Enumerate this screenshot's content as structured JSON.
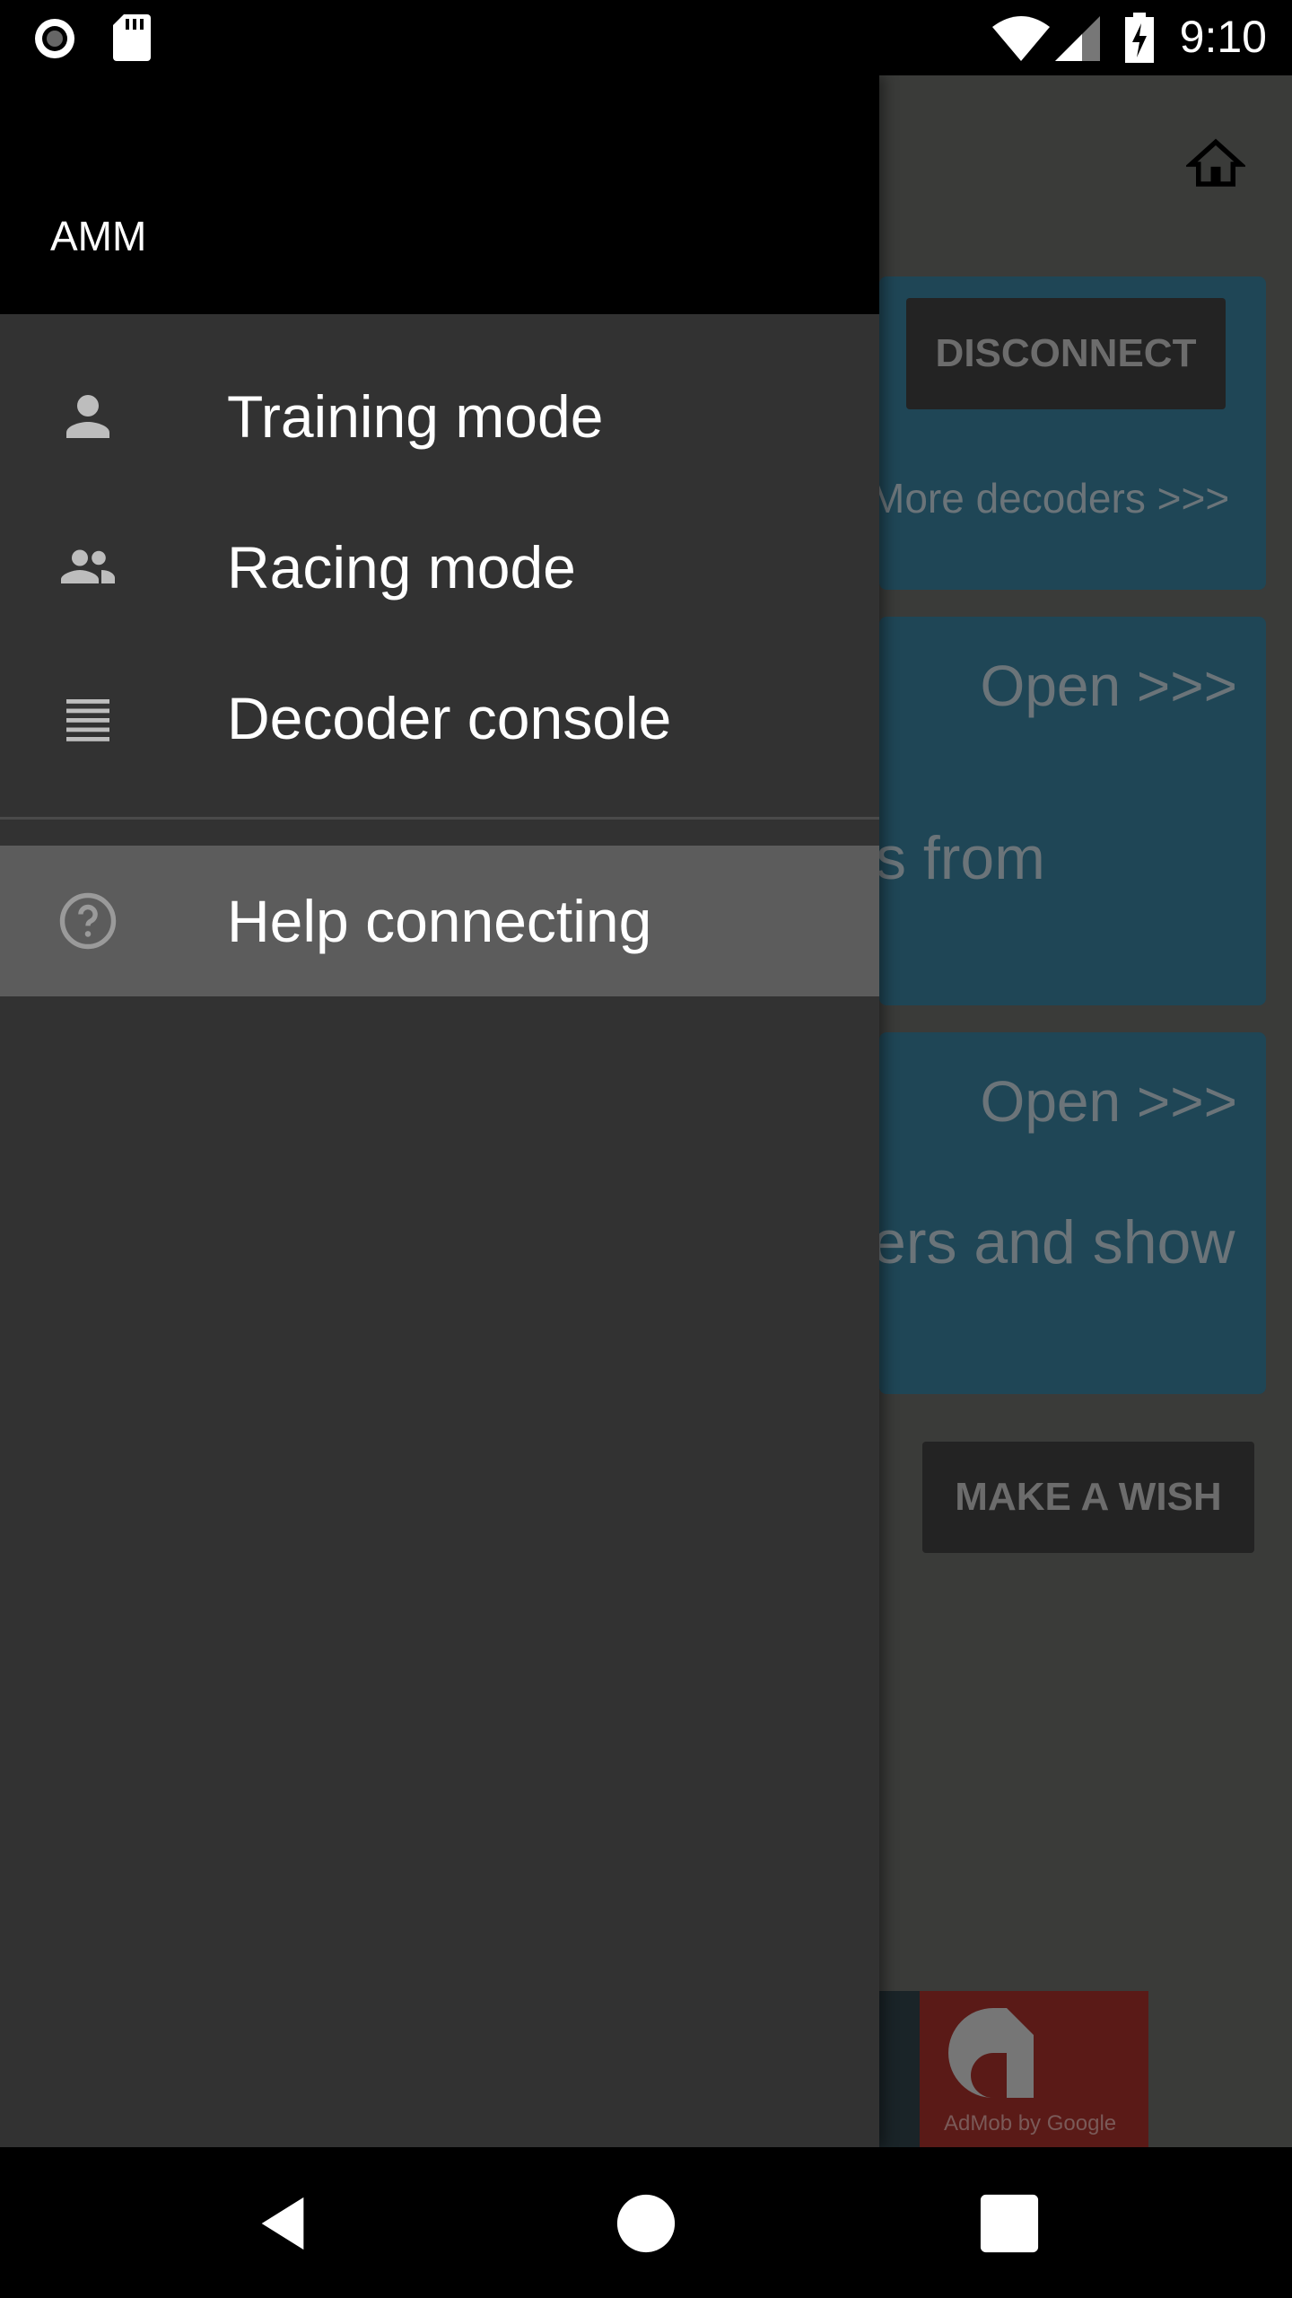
{
  "status_bar": {
    "time": "9:10",
    "icons": [
      "record-icon",
      "sd-card-icon",
      "wifi-icon",
      "signal-icon",
      "battery-charging-icon"
    ]
  },
  "drawer": {
    "title": "AMM",
    "items": [
      {
        "label": "Training mode",
        "icon": "person-icon"
      },
      {
        "label": "Racing mode",
        "icon": "people-icon"
      },
      {
        "label": "Decoder console",
        "icon": "list-icon"
      },
      {
        "label": "Help connecting",
        "icon": "help-circle-icon",
        "selected": true
      }
    ]
  },
  "main": {
    "disconnect_label": "DISCONNECT",
    "more_decoders": "More decoders >>>",
    "card2": {
      "open": "Open >>>",
      "text": "s from"
    },
    "card3": {
      "open": "Open >>>",
      "text": "ers and show"
    },
    "make_wish_label": "MAKE A WISH",
    "ad_text": "AdMob by Google"
  },
  "colors": {
    "drawer_bg": "#323232",
    "selected_bg": "#5c5c5c",
    "card": "#1f4656",
    "header": "#000000"
  }
}
